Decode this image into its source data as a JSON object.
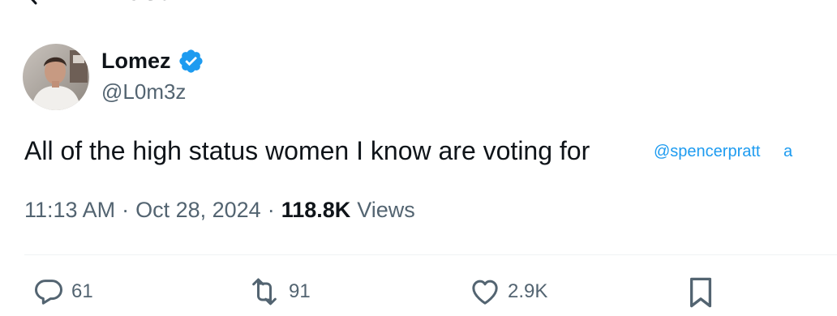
{
  "header": {
    "title": "Post"
  },
  "author": {
    "name": "Lomez",
    "handle": "@L0m3z",
    "verified": true,
    "verified_color": "#1d9bf0"
  },
  "tweet": {
    "text": "All of the high status women I know are voting for",
    "mention": "@spencerpratt",
    "mention_overflow": "a",
    "mention_color": "#1d9bf0"
  },
  "meta": {
    "time": "11:13 AM",
    "separator": "·",
    "date": "Oct 28, 2024",
    "views_count": "118.8K",
    "views_label": "Views"
  },
  "actions": {
    "reply": {
      "icon": "reply-icon",
      "count": "61"
    },
    "repost": {
      "icon": "repost-icon",
      "count": "91"
    },
    "like": {
      "icon": "heart-icon",
      "count": "2.9K"
    },
    "bookmark": {
      "icon": "bookmark-icon"
    }
  },
  "colors": {
    "text_primary": "#0f1419",
    "text_secondary": "#536471",
    "accent": "#1d9bf0",
    "divider": "#eff3f4"
  }
}
